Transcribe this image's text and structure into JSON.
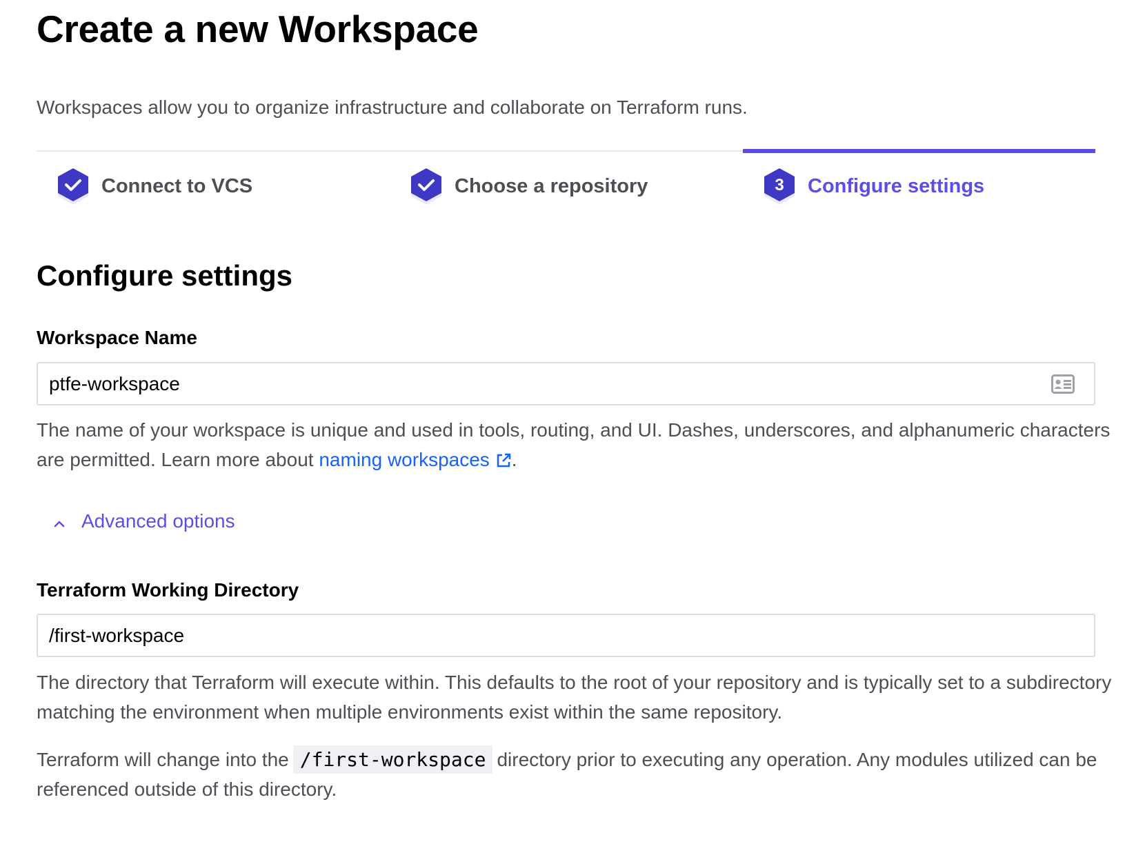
{
  "header": {
    "title": "Create a new Workspace",
    "subtitle": "Workspaces allow you to organize infrastructure and collaborate on Terraform runs."
  },
  "steps": [
    {
      "label": "Connect to VCS",
      "state": "complete"
    },
    {
      "label": "Choose a repository",
      "state": "complete"
    },
    {
      "label": "Configure settings",
      "state": "active",
      "number": "3"
    }
  ],
  "colors": {
    "accent": "#5c4ee5",
    "step_hex": "#3f38c4",
    "link": "#1563ff",
    "muted_text": "#4b4f56"
  },
  "section": {
    "title": "Configure settings"
  },
  "workspace_name": {
    "label": "Workspace Name",
    "value": "ptfe-workspace",
    "help_text": "The name of your workspace is unique and used in tools, routing, and UI. Dashes, underscores, and alphanumeric characters are permitted. Learn more about ",
    "link_text": "naming workspaces",
    "help_suffix": ".",
    "icon": "contact-card-icon"
  },
  "advanced": {
    "label": "Advanced options",
    "expanded": true
  },
  "working_directory": {
    "label": "Terraform Working Directory",
    "value": "/first-workspace",
    "help_text": "The directory that Terraform will execute within. This defaults to the root of your repository and is typically set to a subdirectory matching the environment when multiple environments exist within the same repository.",
    "change_prefix": "Terraform will change into the",
    "change_code": "/first-workspace",
    "change_suffix": "directory prior to executing any operation. Any modules utilized can be referenced outside of this directory."
  }
}
